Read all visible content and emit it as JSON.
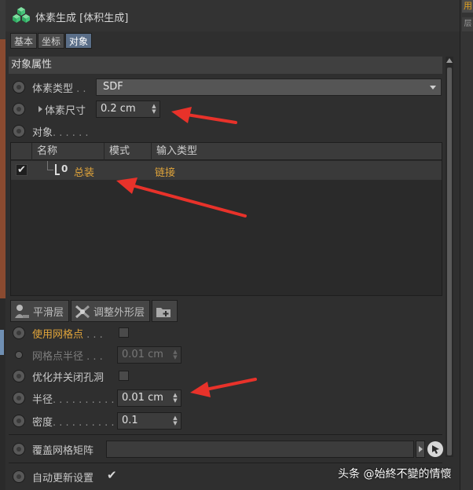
{
  "header": {
    "title": "体素生成 [体积生成]",
    "icon": "voxel-cube-icon"
  },
  "tabs": [
    {
      "label": "基本",
      "active": false
    },
    {
      "label": "坐标",
      "active": false
    },
    {
      "label": "对象",
      "active": true
    }
  ],
  "section_title": "对象属性",
  "props": {
    "voxel_type": {
      "label": "体素类型",
      "dots": " . .",
      "value": "SDF"
    },
    "voxel_size": {
      "label": "体素尺寸",
      "value": "0.2 cm"
    },
    "objects": {
      "label": "对象",
      "dots": ". . . . . ."
    }
  },
  "list": {
    "columns": [
      "名称",
      "模式",
      "输入类型"
    ],
    "rows": [
      {
        "checked": "✔",
        "icon": "null-object-icon",
        "icon_text": "0",
        "name": "总装",
        "input_type": "链接"
      }
    ]
  },
  "layers": [
    {
      "label": "平滑层",
      "icon": "smooth-layer-icon"
    },
    {
      "label": "调整外形层",
      "icon": "reshape-layer-icon"
    },
    {
      "label": "",
      "icon": "add-folder-icon"
    }
  ],
  "options": {
    "use_grid_points": {
      "label": "使用网格点",
      "dots": " . . ."
    },
    "grid_radius": {
      "label": "网格点半径",
      "dots": " . . .",
      "value": "0.01 cm"
    },
    "optimize_close_holes": {
      "label": "优化并关闭孔洞"
    },
    "radius": {
      "label": "半径",
      "dots": ". . . . . . . . . .",
      "value": "0.01 cm"
    },
    "density": {
      "label": "密度",
      "dots": ". . . . . . . . . .",
      "value": "0.1"
    },
    "override_matrix": {
      "label": "覆盖网格矩阵"
    },
    "auto_update": {
      "label": "自动更新设置",
      "checked": "✔"
    }
  },
  "right_strip": {
    "tab1": "用",
    "tab2": "层"
  },
  "watermark": "头条 @始終不變的情懷",
  "colors": {
    "accent_orange": "#e0a43a",
    "active_tab": "#5a6e88",
    "arrow_red": "#e8322a"
  }
}
